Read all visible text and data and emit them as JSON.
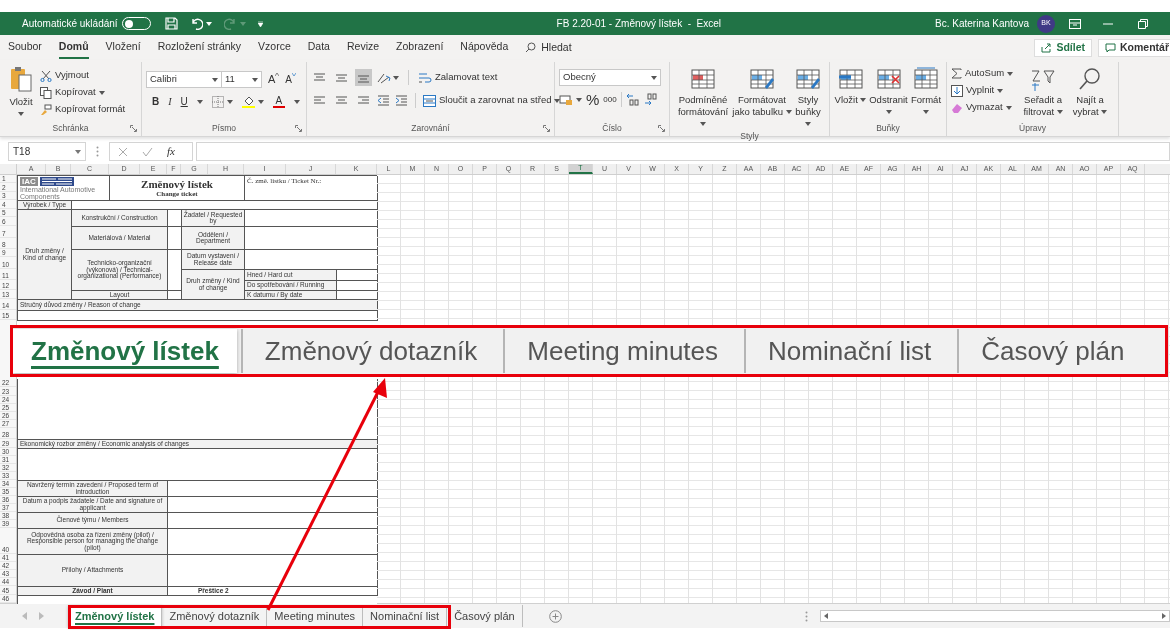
{
  "title_bar": {
    "autosave": {
      "label": "Automatické ukládání",
      "on": false
    },
    "quick_access": [
      {
        "kind": "save",
        "disabled": false
      },
      {
        "kind": "undo",
        "disabled": false
      },
      {
        "kind": "redo",
        "disabled": true
      }
    ],
    "title": "FB 2.20-01 - Změnový lístek  -  Excel",
    "user": "Bc. Katerina Kantova",
    "avatar": "BK"
  },
  "menu": {
    "tabs": [
      {
        "label": "Soubor",
        "selected": false
      },
      {
        "label": "Domů",
        "selected": true
      },
      {
        "label": "Vložení",
        "selected": false
      },
      {
        "label": "Rozložení stránky",
        "selected": false
      },
      {
        "label": "Vzorce",
        "selected": false
      },
      {
        "label": "Data",
        "selected": false
      },
      {
        "label": "Revize",
        "selected": false
      },
      {
        "label": "Zobrazení",
        "selected": false
      },
      {
        "label": "Nápověda",
        "selected": false
      }
    ],
    "search": "Hledat",
    "share": "Sdílet",
    "comments": "Komentář"
  },
  "ribbon": {
    "clipboard": {
      "title": "Schránka",
      "paste": "Vložit",
      "cut": "Vyjmout",
      "copy": "Kopírovat",
      "format_painter": "Kopírovat formát"
    },
    "font": {
      "title": "Písmo",
      "font_name": "Calibri",
      "font_size": "11",
      "grow": "A",
      "shrink": "A",
      "bold": "B",
      "italic": "I",
      "underline": "U",
      "font_color": "A"
    },
    "alignment": {
      "title": "Zarovnání",
      "vertical": [
        {
          "selected": false
        },
        {
          "selected": false
        },
        {
          "selected": true
        }
      ],
      "wrap": "Zalamovat text",
      "merge": "Sloučit a zarovnat na střed"
    },
    "number": {
      "title": "Číslo",
      "format": "Obecný",
      "percent": "%",
      "thousands": "000"
    },
    "styles": {
      "title": "Styly",
      "buttons": [
        "Podmíněné formátování",
        "Formátovat jako tabulku",
        "Styly buňky"
      ]
    },
    "cells": {
      "title": "Buňky",
      "buttons": [
        "Vložit",
        "Odstranit",
        "Formát"
      ]
    },
    "editing": {
      "title": "Úpravy",
      "autosum": "AutoSum",
      "fill": "Vyplnit",
      "clear": "Vymazat",
      "sort": "Seřadit a filtrovat",
      "find": "Najít a vybrat"
    }
  },
  "formula_bar": {
    "name_box": "T18",
    "fx": "fx"
  },
  "columns": [
    {
      "label": "A",
      "selected": false
    },
    {
      "label": "B",
      "selected": false
    },
    {
      "label": "C",
      "selected": false
    },
    {
      "label": "D",
      "selected": false
    },
    {
      "label": "E",
      "selected": false
    },
    {
      "label": "F",
      "selected": false
    },
    {
      "label": "G",
      "selected": false
    },
    {
      "label": "H",
      "selected": false
    },
    {
      "label": "I",
      "selected": false
    },
    {
      "label": "J",
      "selected": false
    },
    {
      "label": "K",
      "selected": false
    },
    {
      "label": "L",
      "selected": false
    },
    {
      "label": "M",
      "selected": false
    },
    {
      "label": "N",
      "selected": false
    },
    {
      "label": "O",
      "selected": false
    },
    {
      "label": "P",
      "selected": false
    },
    {
      "label": "Q",
      "selected": false
    },
    {
      "label": "R",
      "selected": false
    },
    {
      "label": "S",
      "selected": false
    },
    {
      "label": "T",
      "selected": true
    },
    {
      "label": "U",
      "selected": false
    },
    {
      "label": "V",
      "selected": false
    },
    {
      "label": "W",
      "selected": false
    },
    {
      "label": "X",
      "selected": false
    },
    {
      "label": "Y",
      "selected": false
    },
    {
      "label": "Z",
      "selected": false
    },
    {
      "label": "AA",
      "selected": false
    },
    {
      "label": "AB",
      "selected": false
    },
    {
      "label": "AC",
      "selected": false
    },
    {
      "label": "AD",
      "selected": false
    },
    {
      "label": "AE",
      "selected": false
    },
    {
      "label": "AF",
      "selected": false
    },
    {
      "label": "AG",
      "selected": false
    },
    {
      "label": "AH",
      "selected": false
    },
    {
      "label": "AI",
      "selected": false
    },
    {
      "label": "AJ",
      "selected": false
    },
    {
      "label": "AK",
      "selected": false
    },
    {
      "label": "AL",
      "selected": false
    },
    {
      "label": "AM",
      "selected": false
    },
    {
      "label": "AN",
      "selected": false
    },
    {
      "label": "AO",
      "selected": false
    },
    {
      "label": "AP",
      "selected": false
    },
    {
      "label": "AQ",
      "selected": false
    }
  ],
  "row_headers": [
    "1",
    "2",
    "3",
    "4",
    "5",
    "6",
    "7",
    "8",
    "9",
    "10",
    "11",
    "12",
    "13",
    "14",
    "15",
    "22",
    "23",
    "24",
    "25",
    "26",
    "27",
    "28",
    "29",
    "30",
    "31",
    "32",
    "33",
    "34",
    "35",
    "36",
    "37",
    "38",
    "39",
    "40",
    "41",
    "42",
    "43",
    "44",
    "45",
    "46"
  ],
  "form": {
    "logo": {
      "mark": "IAC",
      "caption": "International Automotive Components"
    },
    "title": "Změnový lístek",
    "subtitle": "Change ticket",
    "labels": [
      "Č. změ. lístku / Ticket Nr.:",
      "Výrobek / Type",
      "Druh změny / Kind of change",
      "Konstrukční / Construction",
      "Žadatel / Requested by",
      "Materiálová / Material",
      "Oddělení / Department",
      "Technicko-organizační (výkonová) / Technical-organizational (Performance)",
      "Datum vystavení / Release date",
      "Druh změny / Kind of change",
      "Hned / Hard cut",
      "Do spotřebování / Running",
      "Layout",
      "K datumu / By date",
      "Stručný důvod změny / Reason of change",
      "Ekonomický rozbor změny / Economic analysis of changes",
      "Navržený termín zavedení / Proposed term of introduction",
      "Datum a podpis žadatele / Date and signature of applicant",
      "Členové týmu / Members",
      "Odpovědná osoba za řízení změny (pilot) / Responsible person for managing the change (pilot)",
      "Přílohy / Attachments",
      "Závod / Plant",
      "Přeštice 2"
    ]
  },
  "zoom_callout": {
    "tabs": [
      {
        "label": "Změnový lístek",
        "selected": true
      },
      {
        "label": "Změnový dotazník",
        "selected": false
      },
      {
        "label": "Meeting minutes",
        "selected": false
      },
      {
        "label": "Nominační list",
        "selected": false
      },
      {
        "label": "Časový plán",
        "selected": false
      }
    ]
  },
  "sheet_tabs": [
    {
      "label": "Změnový lístek",
      "selected": true
    },
    {
      "label": "Změnový dotazník",
      "selected": false
    },
    {
      "label": "Meeting minutes",
      "selected": false
    },
    {
      "label": "Nominační list",
      "selected": false
    },
    {
      "label": "Časový plán",
      "selected": false
    }
  ]
}
